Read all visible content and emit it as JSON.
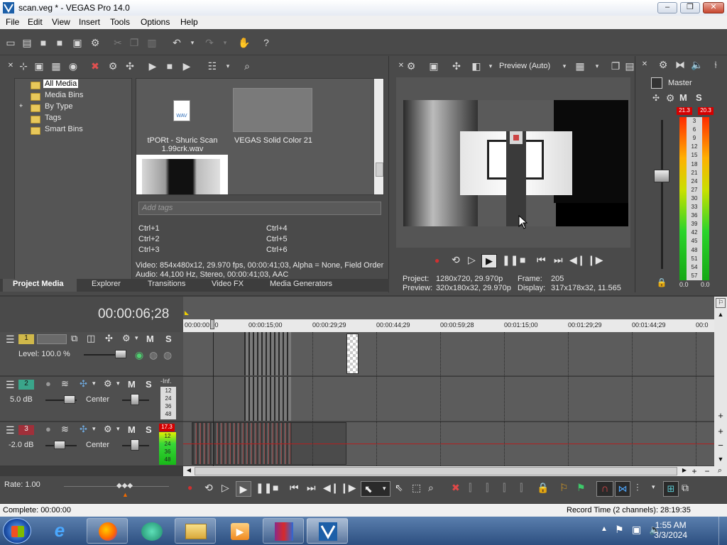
{
  "window": {
    "title": "scan.veg * - VEGAS Pro 14.0",
    "minimize": "–",
    "maximize": "❐",
    "close": "✕"
  },
  "menu": [
    "File",
    "Edit",
    "View",
    "Insert",
    "Tools",
    "Options",
    "Help"
  ],
  "tree": {
    "items": [
      {
        "label": "All Media",
        "selected": true
      },
      {
        "label": "Media Bins"
      },
      {
        "label": "By Type",
        "expand": "+"
      },
      {
        "label": "Tags"
      },
      {
        "label": "Smart Bins"
      }
    ]
  },
  "media": {
    "file1_icon": "WAV",
    "file1_name": "tPORt - Shuric Scan 1.99crk.wav",
    "file2_name": "VEGAS Solid Color 21",
    "tags_placeholder": "Add tags",
    "shortcuts": [
      "Ctrl+1",
      "Ctrl+2",
      "Ctrl+3",
      "Ctrl+4",
      "Ctrl+5",
      "Ctrl+6"
    ],
    "info_video": "Video: 854x480x12, 29.970 fps, 00:00:41;03, Alpha = None, Field Order",
    "info_audio": "Audio: 44,100 Hz, Stereo, 00:00:41;03, AAC"
  },
  "tabs": [
    "Project Media",
    "Explorer",
    "Transitions",
    "Video FX",
    "Media Generators"
  ],
  "preview": {
    "mode": "Preview (Auto)",
    "project_label": "Project:",
    "project_value": "1280x720, 29.970p",
    "preview_label": "Preview:",
    "preview_value": "320x180x32, 29.970p",
    "frame_label": "Frame:",
    "frame_value": "205",
    "display_label": "Display:",
    "display_value": "317x178x32, 11.565"
  },
  "master": {
    "label": "Master",
    "peak_left": "21.3",
    "peak_right": "20.3",
    "scale": [
      "3",
      "6",
      "9",
      "12",
      "15",
      "18",
      "21",
      "24",
      "27",
      "30",
      "33",
      "36",
      "39",
      "42",
      "45",
      "48",
      "51",
      "54",
      "57"
    ],
    "value_left": "0.0",
    "value_right": "0.0",
    "M": "M",
    "S": "S"
  },
  "timeline": {
    "timecode": "00:00:06;28",
    "ruler": [
      "00:00:00;00",
      "00:00:15;00",
      "00:00:29;29",
      "00:00:44;29",
      "00:00:59;28",
      "00:01:15;00",
      "00:01:29;29",
      "00:01:44;29",
      "00:0"
    ],
    "track1": {
      "num": "1",
      "level": "Level: 100.0 %"
    },
    "track2": {
      "num": "2",
      "volume": "5.0 dB",
      "pan": "Center",
      "peak": "-Inf.",
      "scale": [
        "12",
        "24",
        "36",
        "48"
      ]
    },
    "track3": {
      "num": "3",
      "volume": "-2.0 dB",
      "pan": "Center",
      "peak": "17.3",
      "scale": [
        "12",
        "24",
        "36",
        "48"
      ]
    },
    "rate": "Rate: 1.00",
    "M": "M",
    "S": "S"
  },
  "status": {
    "left": "Complete: 00:00:00",
    "right": "Record Time (2 channels): 28:19:35"
  },
  "taskbar": {
    "time": "1:55 AM",
    "date": "3/3/2024"
  }
}
